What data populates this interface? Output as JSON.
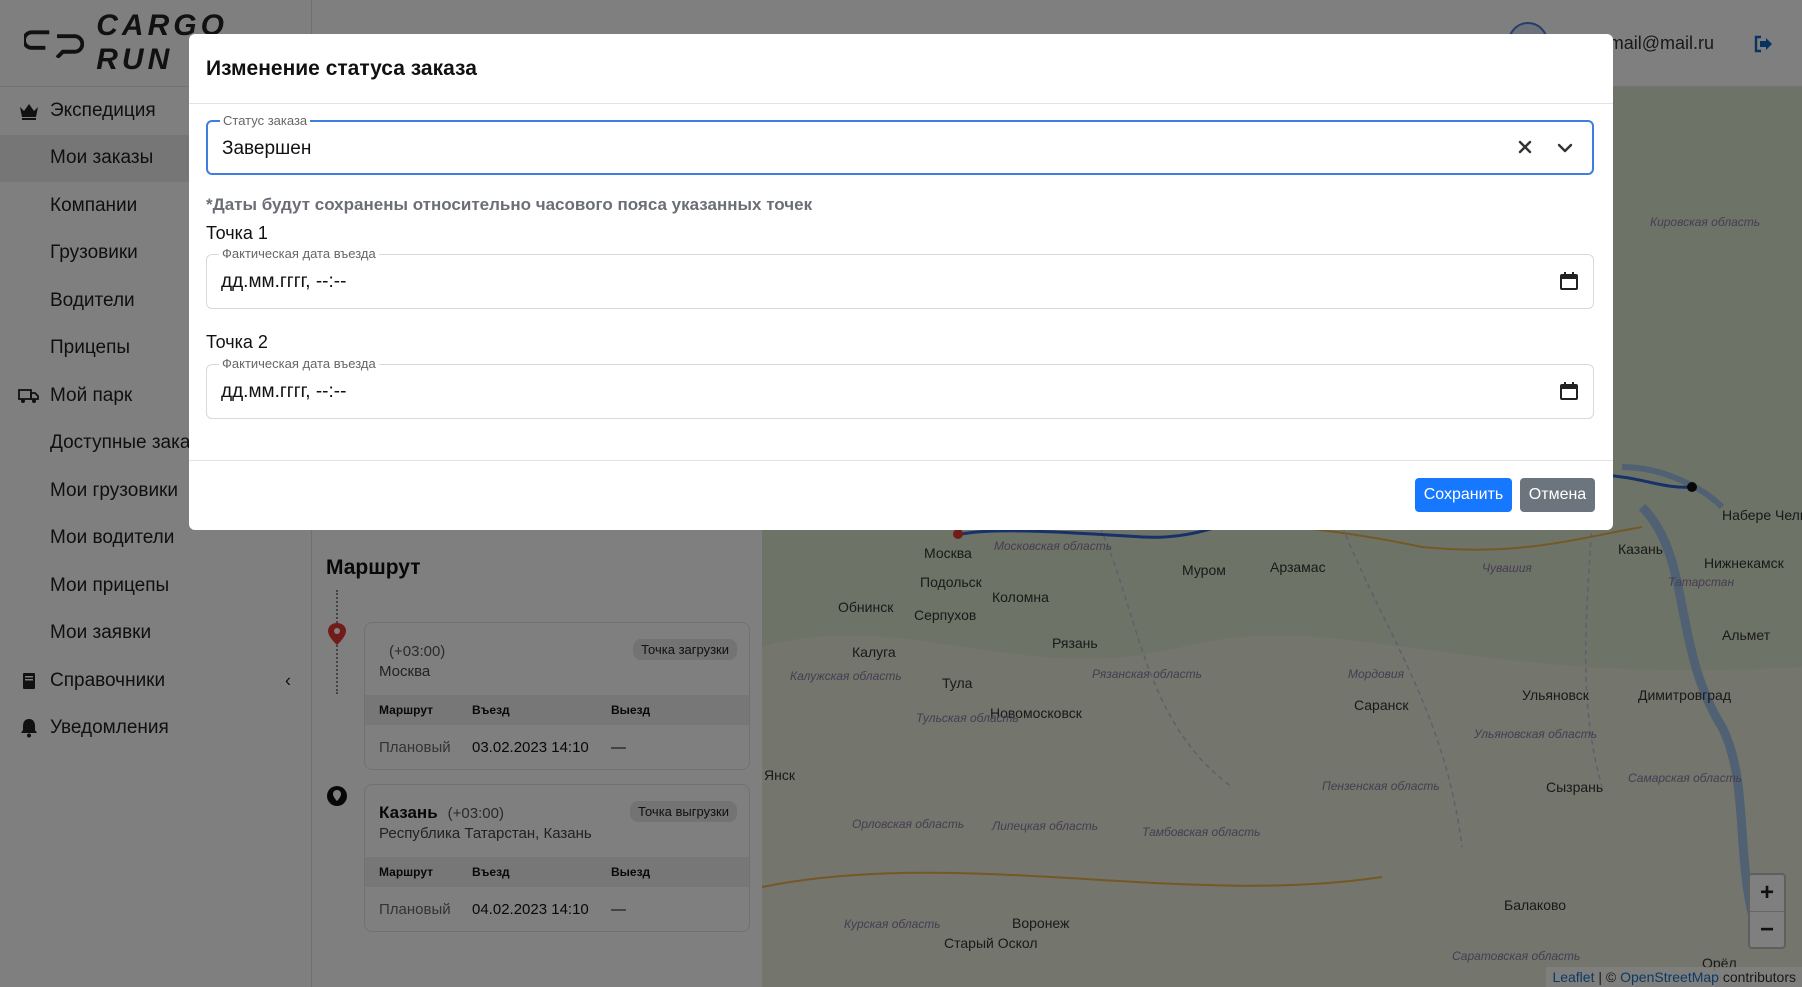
{
  "app": {
    "logo_text": "CARGO RUN",
    "user_email": "mail@mail.ru"
  },
  "sidebar": {
    "sections": [
      {
        "label": "Экспедиция",
        "icon": "crown-icon"
      },
      {
        "label": "Мой парк",
        "icon": "truck-icon"
      },
      {
        "label": "Справочники",
        "icon": "book-icon"
      },
      {
        "label": "Уведомления",
        "icon": "bell-icon"
      }
    ],
    "expedition_items": [
      "Мои заказы",
      "Компании",
      "Грузовики",
      "Водители",
      "Прицепы"
    ],
    "park_items": [
      "Доступные заказы",
      "Мои грузовики",
      "Мои водители",
      "Мои прицепы",
      "Мои заявки"
    ]
  },
  "route": {
    "title": "Маршрут",
    "columns": [
      "Маршрут",
      "Въезд",
      "Выезд"
    ],
    "points": [
      {
        "city": "",
        "tz": "(+03:00)",
        "address": "Москва",
        "badge": "Точка загрузки",
        "row": {
          "type": "Плановый",
          "entry": "03.02.2023 14:10",
          "exit": "—"
        }
      },
      {
        "city": "Казань",
        "tz": "(+03:00)",
        "address": "Республика Татарстан, Казань",
        "badge": "Точка выгрузки",
        "row": {
          "type": "Плановый",
          "entry": "04.02.2023 14:10",
          "exit": "—"
        }
      }
    ]
  },
  "map": {
    "cities": [
      "Москва",
      "Подольск",
      "Коломна",
      "Серпухов",
      "Обнинск",
      "Калуга",
      "Тула",
      "Рязань",
      "Новомосковск",
      "Муром",
      "Арзамас",
      "Саранск",
      "Ульяновск",
      "Димитровград",
      "Сызрань",
      "Казань",
      "Нижнекамск",
      "Балаково",
      "Воронеж",
      "Старый Оскол",
      "Орёл",
      "Набере Челн",
      "Альмет",
      "Янск"
    ],
    "regions": [
      "Кировская область",
      "Московская область",
      "Калужская область",
      "Рязанская область",
      "Тульская область",
      "Мордовия",
      "Пензенская область",
      "Ульяновская область",
      "Самарская область",
      "Орловская область",
      "Липецкая область",
      "Тамбовская область",
      "Курская область",
      "Саратовская область",
      "Чувашия",
      "Татарстан"
    ],
    "zoom_in": "+",
    "zoom_out": "−",
    "attribution_leaflet": "Leaflet",
    "attribution_sep": " | © ",
    "attribution_osm": "OpenStreetMap",
    "attribution_tail": " contributors"
  },
  "modal": {
    "title": "Изменение статуса заказа",
    "status_legend": "Статус заказа",
    "status_value": "Завершен",
    "hint": "*Даты будут сохранены относительно часового пояса указанных точек",
    "points": [
      {
        "label": "Точка 1",
        "legend": "Фактическая дата въезда",
        "value": "дд.мм.гггг, --:--"
      },
      {
        "label": "Точка 2",
        "legend": "Фактическая дата въезда",
        "value": "дд.мм.гггг, --:--"
      }
    ],
    "save_label": "Сохранить",
    "cancel_label": "Отмена"
  },
  "colors": {
    "primary": "#1677ff",
    "secondary": "#6c757d",
    "focus_border": "#3f7de0",
    "route_line": "#2f63d4",
    "pin_red": "#e53935"
  }
}
